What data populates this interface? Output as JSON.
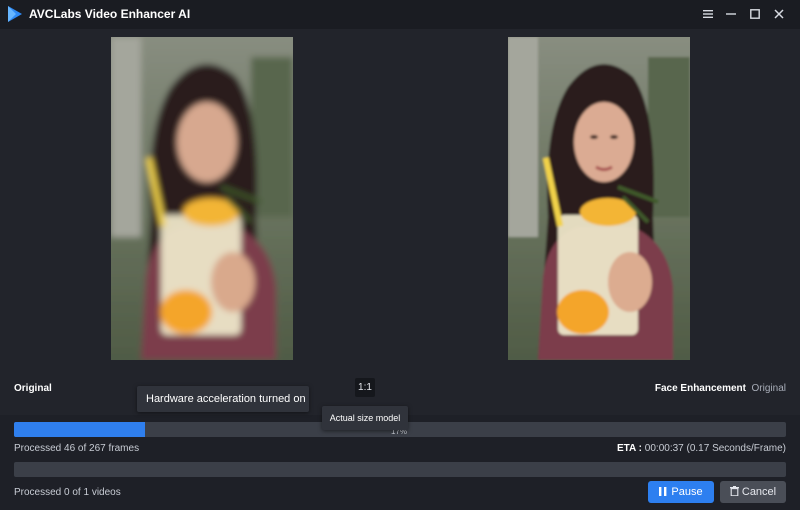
{
  "app": {
    "title": "AVCLabs Video Enhancer AI",
    "brand_color": "#2f8af5"
  },
  "window_controls": [
    "menu-icon",
    "minimize-icon",
    "maximize-icon",
    "close-icon"
  ],
  "preview": {
    "left_label": "Original",
    "right_label": "Face Enhancement",
    "right_toggle": "Original",
    "ratio_button": "1:1"
  },
  "tooltips": {
    "hardware": "Hardware acceleration turned on",
    "ratio": "Actual size model"
  },
  "progress": {
    "frame_fraction": 0.17,
    "frame_label": "17%",
    "frames_text": "Processed 46 of 267 frames",
    "eta_label": "ETA :",
    "eta_value": "00:00:37 (0.17 Seconds/Frame)",
    "video_fraction": 0,
    "videos_text": "Processed 0 of 1 videos"
  },
  "buttons": {
    "pause": "Pause",
    "cancel": "Cancel"
  },
  "colors": {
    "accent": "#2f7fee",
    "track": "#3b3f48",
    "cancel_bg": "#4a4e57"
  }
}
